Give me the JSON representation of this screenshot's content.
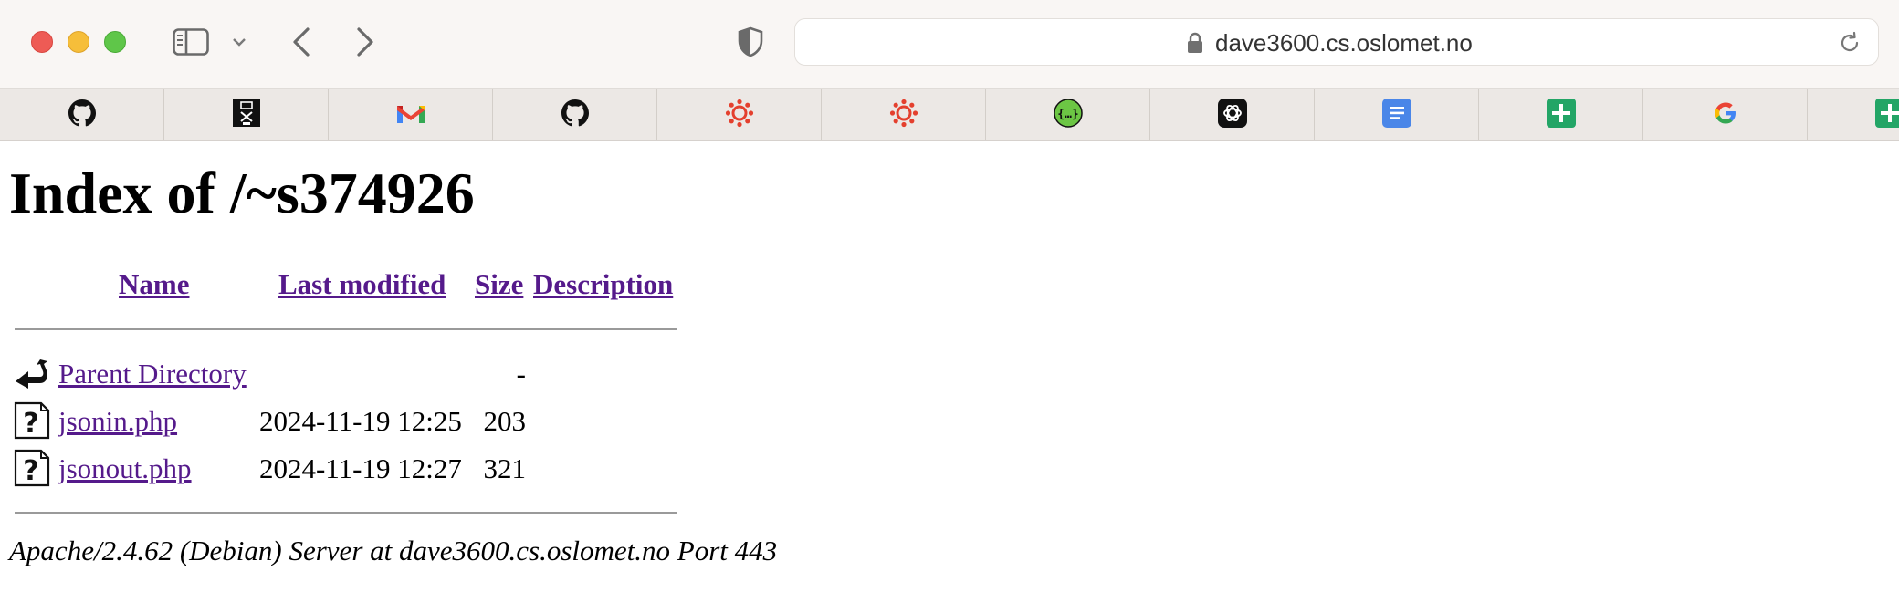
{
  "browser": {
    "url": "dave3600.cs.oslomet.no",
    "favorites": [
      {
        "icon": "github-icon"
      },
      {
        "icon": "oslomet-icon"
      },
      {
        "icon": "gmail-icon"
      },
      {
        "icon": "github-icon"
      },
      {
        "icon": "canvas-icon"
      },
      {
        "icon": "canvas-icon"
      },
      {
        "icon": "json-braces-icon"
      },
      {
        "icon": "openai-icon"
      },
      {
        "icon": "google-docs-icon"
      },
      {
        "icon": "google-sheets-icon"
      },
      {
        "icon": "google-icon"
      },
      {
        "icon": "google-sheets-icon"
      }
    ]
  },
  "listing": {
    "title": "Index of /~s374926",
    "columns": {
      "name": "Name",
      "last_modified": "Last modified",
      "size": "Size",
      "description": "Description"
    },
    "rows": [
      {
        "icon": "back-arrow-icon",
        "name": "Parent Directory",
        "modified": "",
        "size": "-"
      },
      {
        "icon": "unknown-file-icon",
        "name": "jsonin.php",
        "modified": "2024-11-19 12:25",
        "size": "203"
      },
      {
        "icon": "unknown-file-icon",
        "name": "jsonout.php",
        "modified": "2024-11-19 12:27",
        "size": "321"
      }
    ],
    "footer": "Apache/2.4.62 (Debian) Server at dave3600.cs.oslomet.no Port 443"
  },
  "colors": {
    "link": "#551a8b",
    "close": "#ee5b55",
    "minimize": "#f6be3a",
    "zoom": "#5fc649"
  }
}
